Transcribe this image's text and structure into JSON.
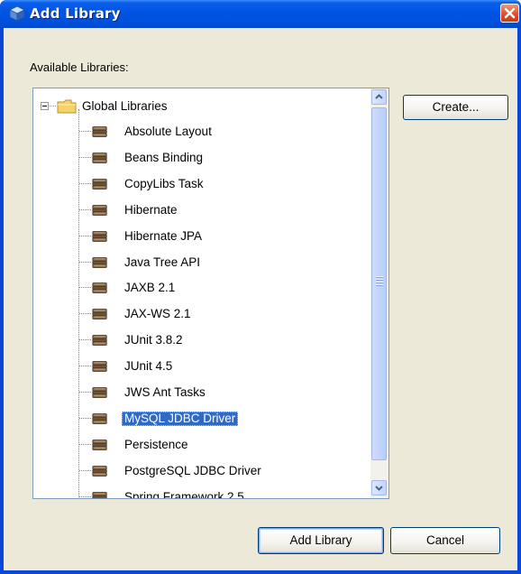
{
  "window": {
    "title": "Add Library",
    "close_icon": "close-icon"
  },
  "available_label": "Available Libraries:",
  "tree": {
    "root": {
      "label": "Global Libraries",
      "expanded": true,
      "icon": "folder-icon"
    },
    "items": [
      {
        "label": "Absolute Layout"
      },
      {
        "label": "Beans Binding"
      },
      {
        "label": "CopyLibs Task"
      },
      {
        "label": "Hibernate"
      },
      {
        "label": "Hibernate JPA"
      },
      {
        "label": "Java Tree API"
      },
      {
        "label": "JAXB 2.1"
      },
      {
        "label": "JAX-WS 2.1"
      },
      {
        "label": "JUnit 3.8.2"
      },
      {
        "label": "JUnit 4.5"
      },
      {
        "label": "JWS Ant Tasks"
      },
      {
        "label": "MySQL JDBC Driver",
        "selected": true
      },
      {
        "label": "Persistence"
      },
      {
        "label": "PostgreSQL JDBC Driver"
      },
      {
        "label": "Spring Framework 2.5"
      }
    ]
  },
  "buttons": {
    "create": "Create...",
    "add_library": "Add Library",
    "cancel": "Cancel"
  },
  "colors": {
    "title_bar": "#0054e3",
    "selection": "#316ac5",
    "dialog_bg": "#ece9d8"
  }
}
